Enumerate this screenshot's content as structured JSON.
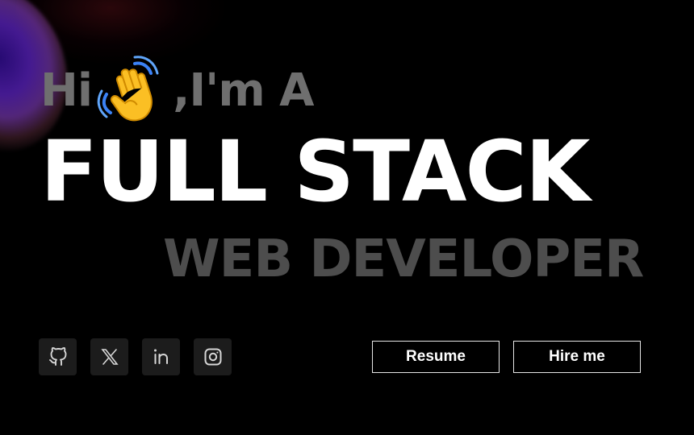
{
  "hero": {
    "greeting": "Hi",
    "intro": ",I'm A",
    "headline": "FULL STACK",
    "subheadline": "WEB DEVELOPER"
  },
  "icons": {
    "wave": "waving-hand-icon",
    "github": "github-icon",
    "x": "x-icon",
    "linkedin": "linkedin-icon",
    "instagram": "instagram-icon"
  },
  "actions": {
    "resume_label": "Resume",
    "hire_label": "Hire me"
  },
  "colors": {
    "background": "#000000",
    "headline": "#ffffff",
    "greeting": "#6f6f6f",
    "subheadline": "#4d4d4d",
    "social_bg": "#1c1c1c"
  }
}
